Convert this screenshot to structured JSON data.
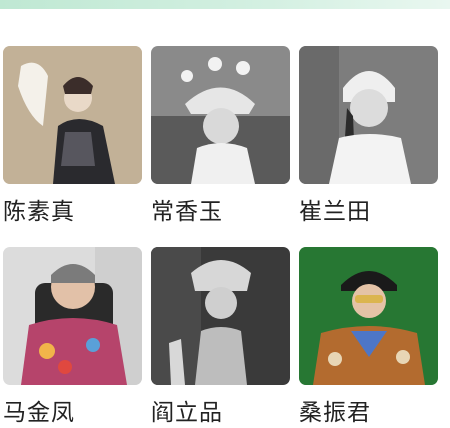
{
  "performers": [
    {
      "name": "陈素真"
    },
    {
      "name": "常香玉"
    },
    {
      "name": "崔兰田"
    },
    {
      "name": "马金凤"
    },
    {
      "name": "阎立品"
    },
    {
      "name": "桑振君"
    }
  ]
}
